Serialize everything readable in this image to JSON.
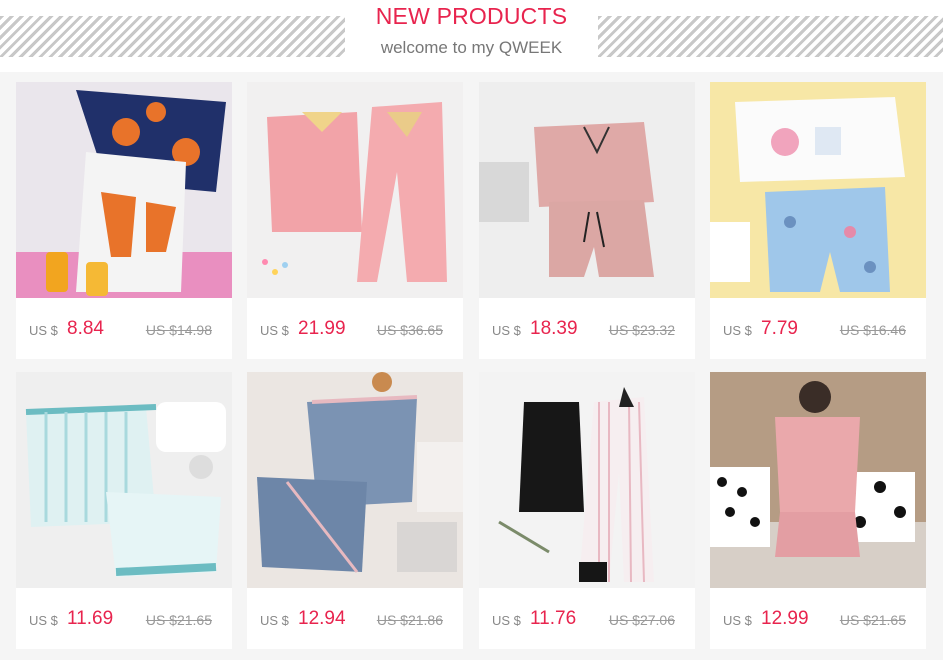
{
  "header": {
    "title": "NEW PRODUCTS",
    "subtitle": "welcome to my QWEEK"
  },
  "products": [
    {
      "image": "fox-cami-pajama-set-photo",
      "currency": "US $",
      "price": "8.84",
      "old_price": "US $14.98"
    },
    {
      "image": "pink-shirt-pants-pajama-photo",
      "currency": "US $",
      "price": "21.99",
      "old_price": "US $36.65"
    },
    {
      "image": "pink-satin-shorts-set-photo",
      "currency": "US $",
      "price": "18.39",
      "old_price": "US $23.32"
    },
    {
      "image": "donut-tee-shorts-set-photo",
      "currency": "US $",
      "price": "7.79",
      "old_price": "US $16.46"
    },
    {
      "image": "striped-mint-shorts-set-photo",
      "currency": "US $",
      "price": "11.69",
      "old_price": "US $21.65"
    },
    {
      "image": "blue-satin-shorts-set-photo",
      "currency": "US $",
      "price": "12.94",
      "old_price": "US $21.86"
    },
    {
      "image": "black-cami-striped-pants-set-photo",
      "currency": "US $",
      "price": "11.76",
      "old_price": "US $27.06"
    },
    {
      "image": "floral-pink-shorts-set-photo",
      "currency": "US $",
      "price": "12.99",
      "old_price": "US $21.65"
    }
  ]
}
